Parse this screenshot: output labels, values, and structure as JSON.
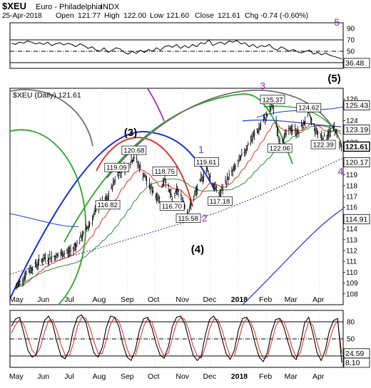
{
  "header": {
    "symbol": "$XEU",
    "name": "Euro - Philadelphia",
    "exchange": "INDX",
    "date": "25-Apr-2018",
    "open_label": "Open",
    "open": "121.77",
    "high_label": "High",
    "high": "122.00",
    "low_label": "Low",
    "low": "121.60",
    "close_label": "Close",
    "close": "121.61",
    "chg_label": "Chg",
    "chg": "-0.74 (-0.60%)"
  },
  "colors": {
    "price": "#000000",
    "last_badge": "#000000",
    "ema_red": "#e0302a",
    "ma_green": "#2e8b2e",
    "ma_blue": "#1a3fc8",
    "cycle_purple": "#a030d8",
    "cycle_green": "#2aa52a",
    "cycle_blue": "#1b2ee8",
    "cycle_red": "#e8201c",
    "cycle_gray": "#707070",
    "wave_label": "#8b2bbf",
    "stoch_k": "#000000",
    "stoch_d": "#d8281e"
  },
  "chart_data": [
    {
      "type": "line",
      "panel": "RSI",
      "ylim": [
        20,
        100
      ],
      "y_ticks": [
        "90",
        "70",
        "50",
        "30"
      ],
      "reference_lines": [
        70,
        50,
        30
      ],
      "last_label": "36.48",
      "last_value": 36.48,
      "series": [
        {
          "values": [
            64,
            62,
            66,
            64,
            68,
            66,
            63,
            65,
            62,
            66,
            60,
            63,
            65,
            61,
            64,
            62,
            58,
            63,
            60,
            55,
            58,
            52,
            50,
            56,
            48,
            52,
            56,
            54,
            48,
            45,
            50,
            46,
            52,
            48,
            53,
            50,
            56,
            52,
            58,
            60,
            57,
            62,
            55,
            60,
            56,
            62,
            58,
            65,
            63,
            70,
            60,
            64,
            66,
            62,
            68,
            66,
            69,
            63,
            65,
            58,
            62,
            56,
            60,
            58,
            62,
            55,
            52,
            58,
            54,
            50,
            53,
            49,
            47,
            50,
            52,
            45,
            48,
            44,
            47,
            43,
            41,
            39,
            36.48
          ]
        }
      ]
    },
    {
      "type": "line",
      "panel": "price",
      "title": "$XEU (Daily) 121.61",
      "last_value": 121.61,
      "ylim": [
        107,
        127
      ],
      "y_ticks": [
        "126",
        "124",
        "122",
        "120",
        "119",
        "118",
        "117",
        "116",
        "115",
        "114",
        "113",
        "112",
        "111",
        "110",
        "109",
        "108"
      ],
      "x_ticks": [
        "May",
        "Jun",
        "Jul",
        "Aug",
        "Sep",
        "Oct",
        "Nov",
        "Dec",
        "2018",
        "Feb",
        "Mar",
        "Apr"
      ],
      "x_bold_tick": "2018",
      "right_labels": [
        "125.43",
        "123.19",
        "121.61",
        "120.17",
        "114.91"
      ],
      "price_annotations": [
        "119.09",
        "120.68",
        "116.82",
        "118.75",
        "116.70",
        "115.58",
        "119.61",
        "117.18",
        "125.37",
        "122.06",
        "124.62",
        "122.39"
      ],
      "wave_labels": [
        "(3)",
        "(4)",
        "(5)",
        "1",
        "2",
        "3",
        "4",
        "5"
      ],
      "series": [
        {
          "name": "XEU",
          "x": [
            "2017-05-01",
            "2017-05-15",
            "2017-06-01",
            "2017-06-15",
            "2017-07-01",
            "2017-07-15",
            "2017-08-01",
            "2017-08-10",
            "2017-08-20",
            "2017-09-01",
            "2017-09-08",
            "2017-09-15",
            "2017-09-25",
            "2017-10-05",
            "2017-10-12",
            "2017-10-20",
            "2017-10-26",
            "2017-11-07",
            "2017-11-15",
            "2017-11-27",
            "2017-12-05",
            "2017-12-12",
            "2017-12-20",
            "2018-01-02",
            "2018-01-12",
            "2018-01-25",
            "2018-02-08",
            "2018-02-16",
            "2018-03-01",
            "2018-03-09",
            "2018-03-20",
            "2018-03-27",
            "2018-04-05",
            "2018-04-17",
            "2018-04-25"
          ],
          "values": [
            108.6,
            110.2,
            111.3,
            111.5,
            112.0,
            113.6,
            116.2,
            116.8,
            119.09,
            119.8,
            120.68,
            119.6,
            118.0,
            116.8,
            118.75,
            116.7,
            117.6,
            115.58,
            117.3,
            119.61,
            118.0,
            117.18,
            118.6,
            120.2,
            121.8,
            123.4,
            125.37,
            122.06,
            123.3,
            122.9,
            124.62,
            123.2,
            122.39,
            123.3,
            121.61
          ]
        }
      ]
    },
    {
      "type": "line",
      "panel": "stochastic",
      "ylim": [
        0,
        100
      ],
      "reference_lines": [
        80,
        50,
        20
      ],
      "y_ticks": [
        "80",
        "50",
        "20"
      ],
      "x_ticks": [
        "May",
        "Jun",
        "Jul",
        "Aug",
        "Sep",
        "Oct",
        "Nov",
        "Dec",
        "2018",
        "Feb",
        "Mar",
        "Apr"
      ],
      "x_bold_tick": "2018",
      "last_labels": [
        "24.59",
        "8.10"
      ],
      "series": [
        {
          "name": "%K",
          "values": [
            72,
            85,
            88,
            60,
            30,
            18,
            22,
            55,
            82,
            90,
            76,
            45,
            20,
            15,
            30,
            66,
            88,
            92,
            80,
            50,
            25,
            18,
            35,
            70,
            90,
            88,
            72,
            40,
            18,
            12,
            30,
            65,
            85,
            88,
            70,
            42,
            22,
            16,
            36,
            72,
            88,
            90,
            76,
            48,
            22,
            12,
            20,
            58,
            84,
            90,
            78,
            50,
            24,
            14,
            30,
            66,
            86,
            88,
            72,
            42,
            18,
            10,
            26,
            62,
            84,
            86,
            70,
            44,
            20,
            14,
            40,
            78,
            88,
            60,
            26,
            12,
            30,
            64,
            82,
            86,
            8.1
          ]
        },
        {
          "name": "%D",
          "values": [
            60,
            75,
            84,
            75,
            52,
            30,
            22,
            35,
            62,
            82,
            84,
            65,
            40,
            22,
            20,
            42,
            72,
            88,
            86,
            70,
            45,
            25,
            24,
            48,
            76,
            88,
            82,
            60,
            32,
            18,
            20,
            45,
            72,
            85,
            80,
            58,
            34,
            20,
            25,
            52,
            78,
            88,
            84,
            64,
            38,
            20,
            16,
            36,
            68,
            85,
            84,
            66,
            40,
            20,
            20,
            46,
            75,
            86,
            80,
            60,
            32,
            16,
            18,
            44,
            72,
            84,
            80,
            60,
            34,
            18,
            26,
            56,
            80,
            74,
            44,
            20,
            20,
            46,
            70,
            82,
            24.59
          ]
        }
      ]
    }
  ]
}
